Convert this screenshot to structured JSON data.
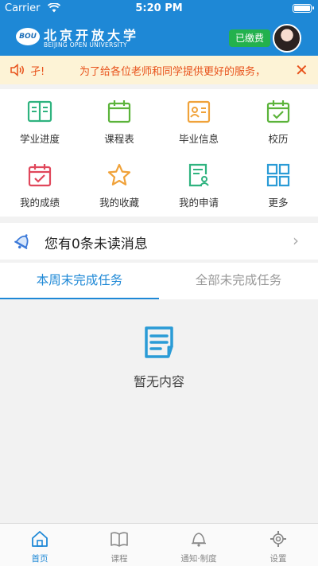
{
  "status_bar": {
    "carrier": "Carrier",
    "time": "5:20 PM"
  },
  "header": {
    "logo_emblem": "BOU",
    "logo_cn": "北京开放大学",
    "logo_en": "BEIJING OPEN UNIVERSITY",
    "paid_label": "已缴费",
    "brand_color": "#1e88d6"
  },
  "notice": {
    "prefix": "孑!",
    "text": "为了给各位老师和同学提供更好的服务，",
    "close": "✕",
    "icon": "speaker-icon"
  },
  "grid": {
    "items": [
      {
        "label": "学业进度",
        "icon": "book-icon",
        "color": "#2fb37f"
      },
      {
        "label": "课程表",
        "icon": "calendar-icon",
        "color": "#5bb33a"
      },
      {
        "label": "毕业信息",
        "icon": "id-card-icon",
        "color": "#f0a23a"
      },
      {
        "label": "校历",
        "icon": "calendar-check-icon",
        "color": "#5bb33a"
      },
      {
        "label": "我的成绩",
        "icon": "calendar-check-icon",
        "color": "#e0475b"
      },
      {
        "label": "我的收藏",
        "icon": "star-icon",
        "color": "#f0a23a"
      },
      {
        "label": "我的申请",
        "icon": "form-user-icon",
        "color": "#2fb37f"
      },
      {
        "label": "更多",
        "icon": "grid-icon",
        "color": "#2a9bd6"
      }
    ]
  },
  "messages": {
    "text": "您有0条未读消息",
    "chevron": "›"
  },
  "tabs": [
    {
      "label": "本周末完成任务",
      "active": true
    },
    {
      "label": "全部未完成任务",
      "active": false
    }
  ],
  "empty_state": {
    "text": "暂无内容"
  },
  "bottom_nav": {
    "items": [
      {
        "label": "首页",
        "icon": "home-icon",
        "active": true
      },
      {
        "label": "课程",
        "icon": "open-book-icon",
        "active": false
      },
      {
        "label": "通知·制度",
        "icon": "bell-icon",
        "active": false
      },
      {
        "label": "设置",
        "icon": "gear-icon",
        "active": false
      }
    ]
  }
}
